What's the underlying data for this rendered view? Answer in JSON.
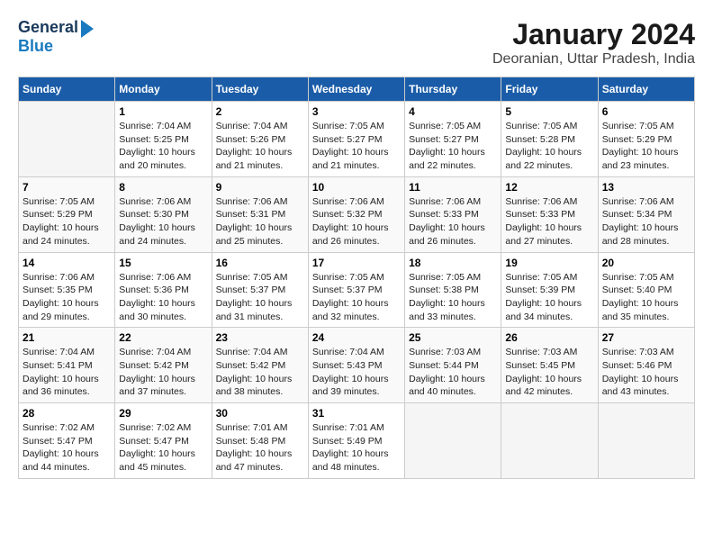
{
  "header": {
    "logo_line1": "General",
    "logo_line2": "Blue",
    "title": "January 2024",
    "subtitle": "Deoranian, Uttar Pradesh, India"
  },
  "days_of_week": [
    "Sunday",
    "Monday",
    "Tuesday",
    "Wednesday",
    "Thursday",
    "Friday",
    "Saturday"
  ],
  "weeks": [
    [
      {
        "num": "",
        "info": ""
      },
      {
        "num": "1",
        "info": "Sunrise: 7:04 AM\nSunset: 5:25 PM\nDaylight: 10 hours\nand 20 minutes."
      },
      {
        "num": "2",
        "info": "Sunrise: 7:04 AM\nSunset: 5:26 PM\nDaylight: 10 hours\nand 21 minutes."
      },
      {
        "num": "3",
        "info": "Sunrise: 7:05 AM\nSunset: 5:27 PM\nDaylight: 10 hours\nand 21 minutes."
      },
      {
        "num": "4",
        "info": "Sunrise: 7:05 AM\nSunset: 5:27 PM\nDaylight: 10 hours\nand 22 minutes."
      },
      {
        "num": "5",
        "info": "Sunrise: 7:05 AM\nSunset: 5:28 PM\nDaylight: 10 hours\nand 22 minutes."
      },
      {
        "num": "6",
        "info": "Sunrise: 7:05 AM\nSunset: 5:29 PM\nDaylight: 10 hours\nand 23 minutes."
      }
    ],
    [
      {
        "num": "7",
        "info": "Sunrise: 7:05 AM\nSunset: 5:29 PM\nDaylight: 10 hours\nand 24 minutes."
      },
      {
        "num": "8",
        "info": "Sunrise: 7:06 AM\nSunset: 5:30 PM\nDaylight: 10 hours\nand 24 minutes."
      },
      {
        "num": "9",
        "info": "Sunrise: 7:06 AM\nSunset: 5:31 PM\nDaylight: 10 hours\nand 25 minutes."
      },
      {
        "num": "10",
        "info": "Sunrise: 7:06 AM\nSunset: 5:32 PM\nDaylight: 10 hours\nand 26 minutes."
      },
      {
        "num": "11",
        "info": "Sunrise: 7:06 AM\nSunset: 5:33 PM\nDaylight: 10 hours\nand 26 minutes."
      },
      {
        "num": "12",
        "info": "Sunrise: 7:06 AM\nSunset: 5:33 PM\nDaylight: 10 hours\nand 27 minutes."
      },
      {
        "num": "13",
        "info": "Sunrise: 7:06 AM\nSunset: 5:34 PM\nDaylight: 10 hours\nand 28 minutes."
      }
    ],
    [
      {
        "num": "14",
        "info": "Sunrise: 7:06 AM\nSunset: 5:35 PM\nDaylight: 10 hours\nand 29 minutes."
      },
      {
        "num": "15",
        "info": "Sunrise: 7:06 AM\nSunset: 5:36 PM\nDaylight: 10 hours\nand 30 minutes."
      },
      {
        "num": "16",
        "info": "Sunrise: 7:05 AM\nSunset: 5:37 PM\nDaylight: 10 hours\nand 31 minutes."
      },
      {
        "num": "17",
        "info": "Sunrise: 7:05 AM\nSunset: 5:37 PM\nDaylight: 10 hours\nand 32 minutes."
      },
      {
        "num": "18",
        "info": "Sunrise: 7:05 AM\nSunset: 5:38 PM\nDaylight: 10 hours\nand 33 minutes."
      },
      {
        "num": "19",
        "info": "Sunrise: 7:05 AM\nSunset: 5:39 PM\nDaylight: 10 hours\nand 34 minutes."
      },
      {
        "num": "20",
        "info": "Sunrise: 7:05 AM\nSunset: 5:40 PM\nDaylight: 10 hours\nand 35 minutes."
      }
    ],
    [
      {
        "num": "21",
        "info": "Sunrise: 7:04 AM\nSunset: 5:41 PM\nDaylight: 10 hours\nand 36 minutes."
      },
      {
        "num": "22",
        "info": "Sunrise: 7:04 AM\nSunset: 5:42 PM\nDaylight: 10 hours\nand 37 minutes."
      },
      {
        "num": "23",
        "info": "Sunrise: 7:04 AM\nSunset: 5:42 PM\nDaylight: 10 hours\nand 38 minutes."
      },
      {
        "num": "24",
        "info": "Sunrise: 7:04 AM\nSunset: 5:43 PM\nDaylight: 10 hours\nand 39 minutes."
      },
      {
        "num": "25",
        "info": "Sunrise: 7:03 AM\nSunset: 5:44 PM\nDaylight: 10 hours\nand 40 minutes."
      },
      {
        "num": "26",
        "info": "Sunrise: 7:03 AM\nSunset: 5:45 PM\nDaylight: 10 hours\nand 42 minutes."
      },
      {
        "num": "27",
        "info": "Sunrise: 7:03 AM\nSunset: 5:46 PM\nDaylight: 10 hours\nand 43 minutes."
      }
    ],
    [
      {
        "num": "28",
        "info": "Sunrise: 7:02 AM\nSunset: 5:47 PM\nDaylight: 10 hours\nand 44 minutes."
      },
      {
        "num": "29",
        "info": "Sunrise: 7:02 AM\nSunset: 5:47 PM\nDaylight: 10 hours\nand 45 minutes."
      },
      {
        "num": "30",
        "info": "Sunrise: 7:01 AM\nSunset: 5:48 PM\nDaylight: 10 hours\nand 47 minutes."
      },
      {
        "num": "31",
        "info": "Sunrise: 7:01 AM\nSunset: 5:49 PM\nDaylight: 10 hours\nand 48 minutes."
      },
      {
        "num": "",
        "info": ""
      },
      {
        "num": "",
        "info": ""
      },
      {
        "num": "",
        "info": ""
      }
    ]
  ]
}
